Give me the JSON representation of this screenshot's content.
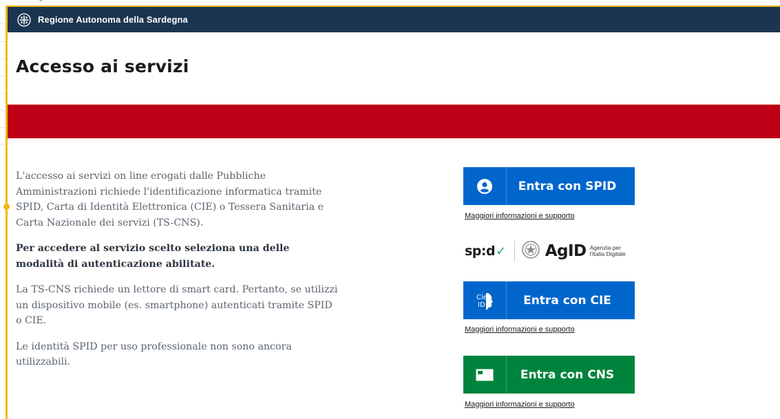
{
  "header": {
    "emblem_icon": "sardinia-emblem-icon",
    "region_name": "Regione Autonoma della Sardegna",
    "bg_color": "#1b3550"
  },
  "page": {
    "title": "Accesso ai servizi",
    "band_color": "#be0017"
  },
  "content": {
    "paragraphs": [
      "L'accesso ai servizi on line erogati dalle Pubbliche Amministrazioni richiede l'identificazione informatica tramite SPID, Carta di Identità Elettronica (CIE) o Tessera Sanitaria e Carta Nazionale dei servizi (TS-CNS).",
      "Per accedere al servizio scelto seleziona una delle modalità di autenticazione abilitate.",
      "La TS-CNS richiede un lettore di smart card. Pertanto, se utilizzi un dispositivo mobile (es. smartphone) autenticati tramite SPID o CIE.",
      "Le identità SPID per uso professionale non sono ancora utilizzabili."
    ]
  },
  "login": {
    "spid": {
      "label": "Entra con SPID",
      "icon": "user-circle-icon",
      "info_link": "Maggiori informazioni e supporto",
      "color": "#0066cc"
    },
    "logos": {
      "spid_text": "sp:d",
      "agid_text": "AgID",
      "agid_sub_line1": "Agenzia per",
      "agid_sub_line2": "l'Italia Digitale"
    },
    "cie": {
      "label": "Entra con CIE",
      "icon": "cie-id-icon",
      "icon_text_top": "Cie",
      "icon_text_bottom": "ID",
      "info_link": "Maggiori informazioni e supporto",
      "color": "#0066cc"
    },
    "cns": {
      "label": "Entra con CNS",
      "icon": "smart-card-icon",
      "info_link": "Maggiori informazioni e supporto",
      "color": "#00843d"
    }
  }
}
